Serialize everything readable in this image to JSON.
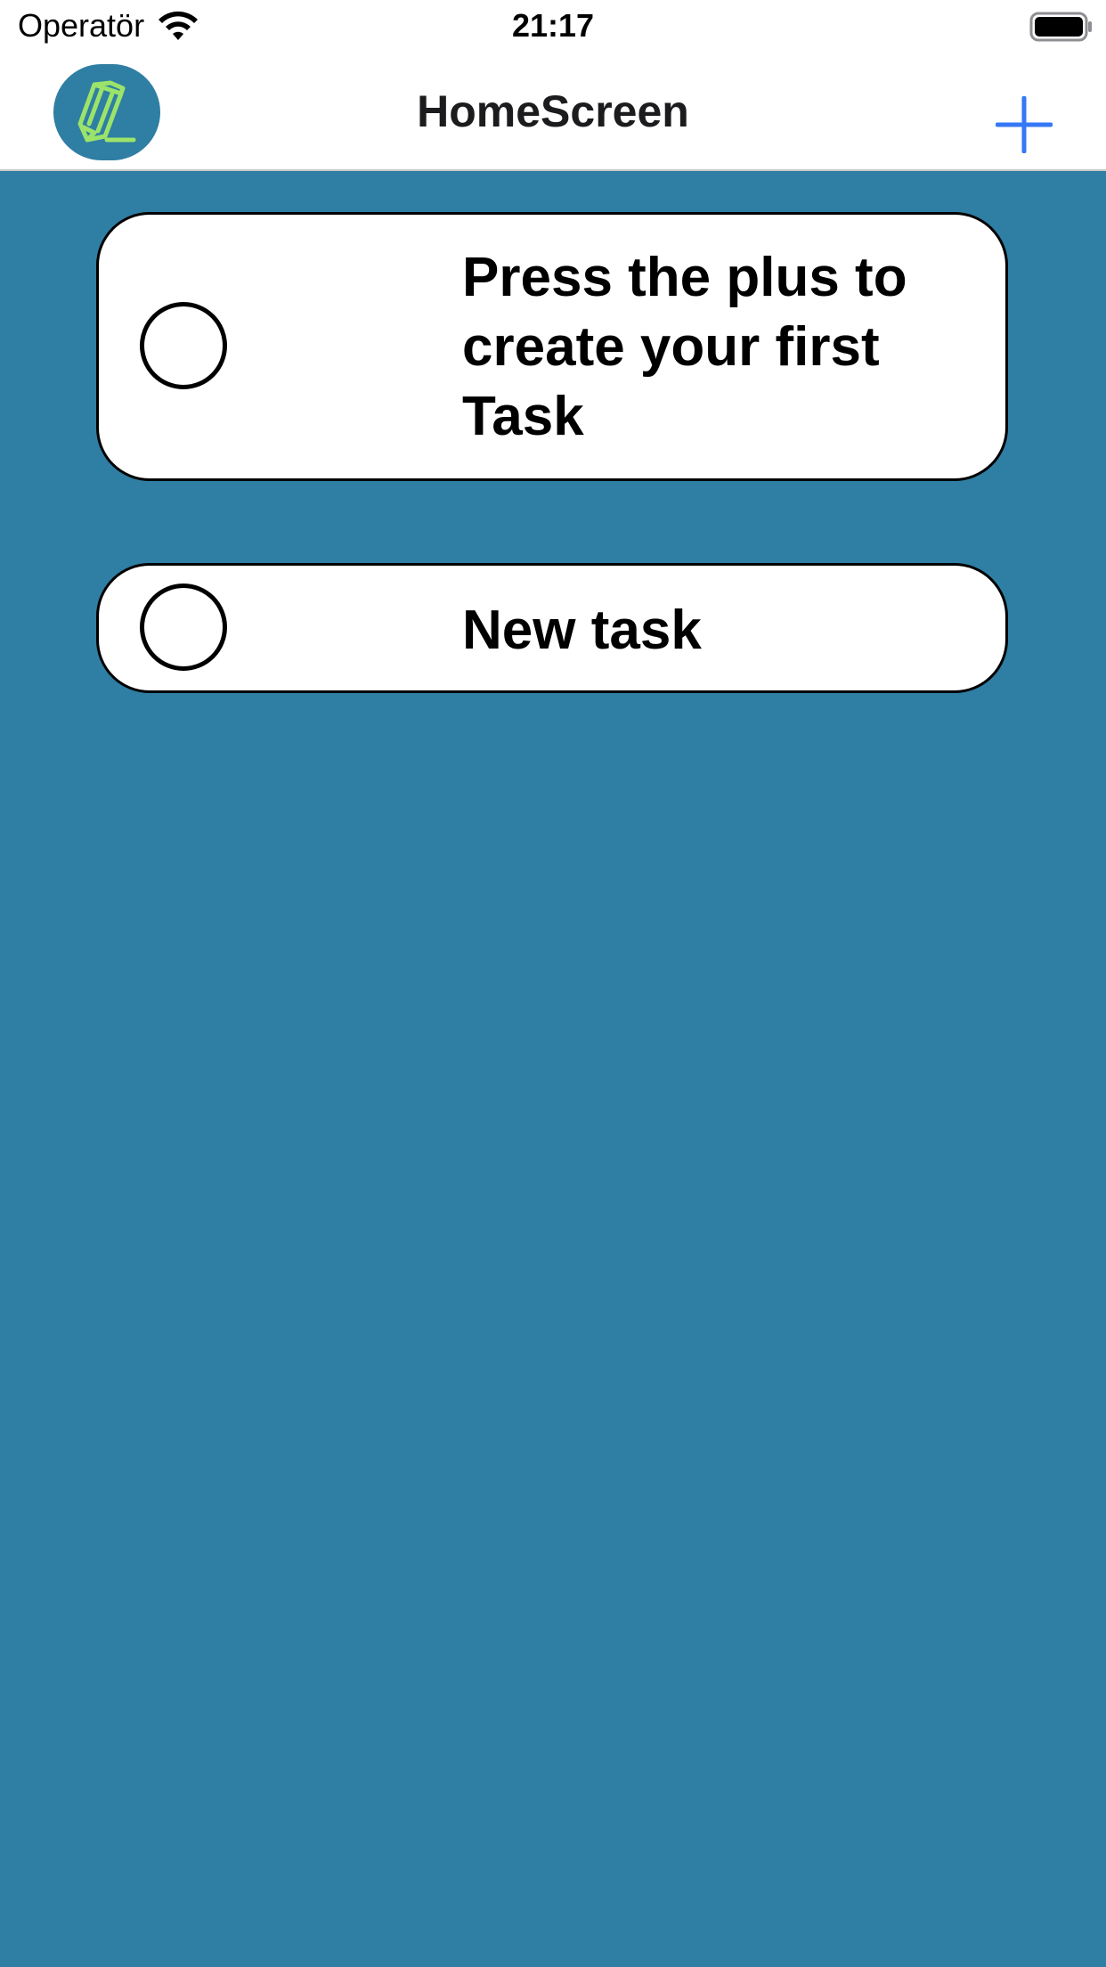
{
  "status_bar": {
    "carrier": "Operatör",
    "time": "21:17",
    "wifi_icon": "wifi-icon",
    "battery_icon": "battery-full-icon"
  },
  "nav": {
    "title": "HomeScreen",
    "logo_icon": "pencil-icon",
    "add_icon": "plus-icon",
    "accent_color": "#3478f6"
  },
  "tasks": [
    {
      "text": "Press the plus to create your first Task",
      "done": false
    },
    {
      "text": "New task",
      "done": false
    }
  ],
  "colors": {
    "background": "#2f7ea3",
    "logo_green": "#9be36a",
    "card_background": "#ffffff"
  }
}
